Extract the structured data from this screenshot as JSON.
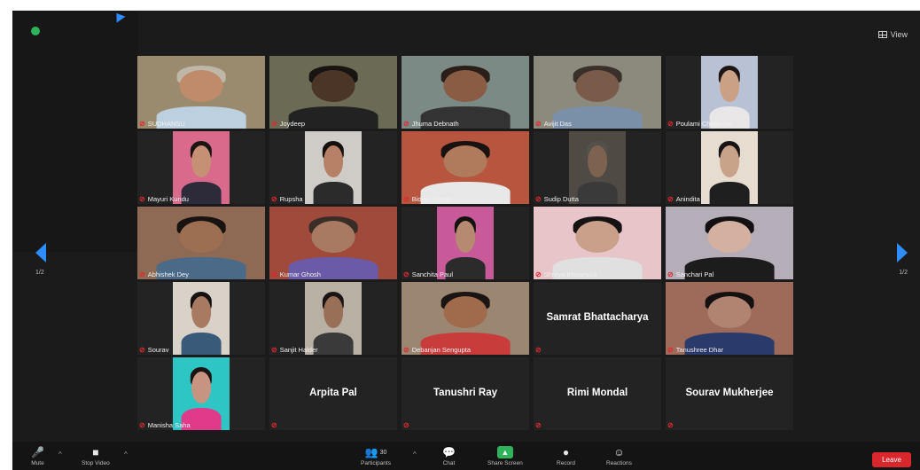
{
  "window": {
    "view_label": "View"
  },
  "pagination": {
    "left": "1/2",
    "right": "1/2"
  },
  "participants": [
    {
      "name": "SUDHANSU",
      "video": true,
      "bg": "#9a8b6e",
      "skin": "#c08b6a",
      "hair": "#bfb7a8",
      "shirt": "#bcd0df"
    },
    {
      "name": "Joydeep",
      "video": true,
      "bg": "#6a6a55",
      "skin": "#4a3526",
      "hair": "#1a1410",
      "shirt": "#222"
    },
    {
      "name": "Jhuma Debnath",
      "video": true,
      "bg": "#7c8a86",
      "skin": "#8a5c44",
      "hair": "#2a1f18",
      "shirt": "#333"
    },
    {
      "name": "Avijit Das",
      "video": true,
      "bg": "#8b8a7c",
      "skin": "#7a5a48",
      "hair": "#3a302a",
      "shirt": "#7a8fa8"
    },
    {
      "name": "Poulami Chatterjee",
      "video": true,
      "narrow": true,
      "bg": "#b9c2d4",
      "skin": "#caa184",
      "hair": "#1d1513",
      "shirt": "#e9e6e8"
    },
    {
      "name": "Mayuri Kundu",
      "video": true,
      "narrow": true,
      "bg": "#d96a8c",
      "skin": "#c69075",
      "hair": "#1b1412",
      "shirt": "#2d2a3a"
    },
    {
      "name": "Rupsha",
      "video": true,
      "narrow": true,
      "bg": "#cfcbc6",
      "skin": "#b68066",
      "hair": "#141010",
      "shirt": "#2b2b2b"
    },
    {
      "name": "Bidyut Ghosh",
      "video": true,
      "bg": "#b8553e",
      "skin": "#b07a5c",
      "hair": "#191210",
      "shirt": "#e8e8e8"
    },
    {
      "name": "Sudip Dutta",
      "video": true,
      "narrow": true,
      "bg": "#4f4a44",
      "skin": "#7d6250",
      "hair": "#54504a",
      "shirt": "#3a3a3a"
    },
    {
      "name": "Anindita",
      "video": true,
      "narrow": true,
      "bg": "#e6dcd0",
      "skin": "#c9a28a",
      "hair": "#181314",
      "shirt": "#1f1f1f"
    },
    {
      "name": "Abhishek Dey",
      "video": true,
      "bg": "#8e6a54",
      "skin": "#9c6e52",
      "hair": "#181210",
      "shirt": "#4a6a88"
    },
    {
      "name": "Kumar Ghosh",
      "video": true,
      "bg": "#a04a3c",
      "skin": "#a87a62",
      "hair": "#3a2c26",
      "shirt": "#6b5aa8"
    },
    {
      "name": "Sanchita Paul",
      "video": true,
      "narrow": true,
      "bg": "#c85a9a",
      "skin": "#b58a70",
      "hair": "#141010",
      "shirt": "#2b2b2b"
    },
    {
      "name": "Shreya Bhowmick",
      "video": true,
      "bg": "#e7c5c8",
      "skin": "#c9a08a",
      "hair": "#161112",
      "shirt": "#e0e0e0"
    },
    {
      "name": "Sanchari Pal",
      "video": true,
      "bg": "#b5adb8",
      "skin": "#d4b0a0",
      "hair": "#121010",
      "shirt": "#1c1c1c"
    },
    {
      "name": "Sourav",
      "video": true,
      "narrow": true,
      "bg": "#d8d2c8",
      "skin": "#a87a62",
      "hair": "#171211",
      "shirt": "#3a5a7a"
    },
    {
      "name": "Sanjit Halder",
      "video": true,
      "narrow": true,
      "bg": "#b9b0a4",
      "skin": "#9a6f58",
      "hair": "#1a1514",
      "shirt": "#3a3a3a"
    },
    {
      "name": "Debanjan Sengupta",
      "video": true,
      "bg": "#9b8672",
      "skin": "#a06a4c",
      "hair": "#1a1412",
      "shirt": "#c83c3c"
    },
    {
      "name": "Samrat Bhattacharya",
      "video": false
    },
    {
      "name": "Tanushree Dhar",
      "video": true,
      "bg": "#9e6a5a",
      "skin": "#b08470",
      "hair": "#151110",
      "shirt": "#2a3a6a"
    },
    {
      "name": "Manisha Saha",
      "video": true,
      "narrow": true,
      "bg": "#2ec6c4",
      "skin": "#c79482",
      "hair": "#1a1412",
      "shirt": "#e03a8a"
    },
    {
      "name": "Arpita Pal",
      "video": false
    },
    {
      "name": "Tanushri Ray",
      "video": false
    },
    {
      "name": "Rimi Mondal",
      "video": false
    },
    {
      "name": "Sourav Mukherjee",
      "video": false
    }
  ],
  "toolbar": {
    "items": [
      {
        "id": "mute",
        "label": "Mute",
        "icon": "🎤"
      },
      {
        "id": "video",
        "label": "Stop Video",
        "icon": "■"
      },
      {
        "id": "participants",
        "label": "Participants",
        "icon": "👥",
        "count": "30"
      },
      {
        "id": "chat",
        "label": "Chat",
        "icon": "💬"
      },
      {
        "id": "share",
        "label": "Share Screen",
        "icon": "▲"
      },
      {
        "id": "record",
        "label": "Record",
        "icon": "●"
      },
      {
        "id": "reactions",
        "label": "Reactions",
        "icon": "☺"
      }
    ],
    "leave_label": "Leave"
  }
}
